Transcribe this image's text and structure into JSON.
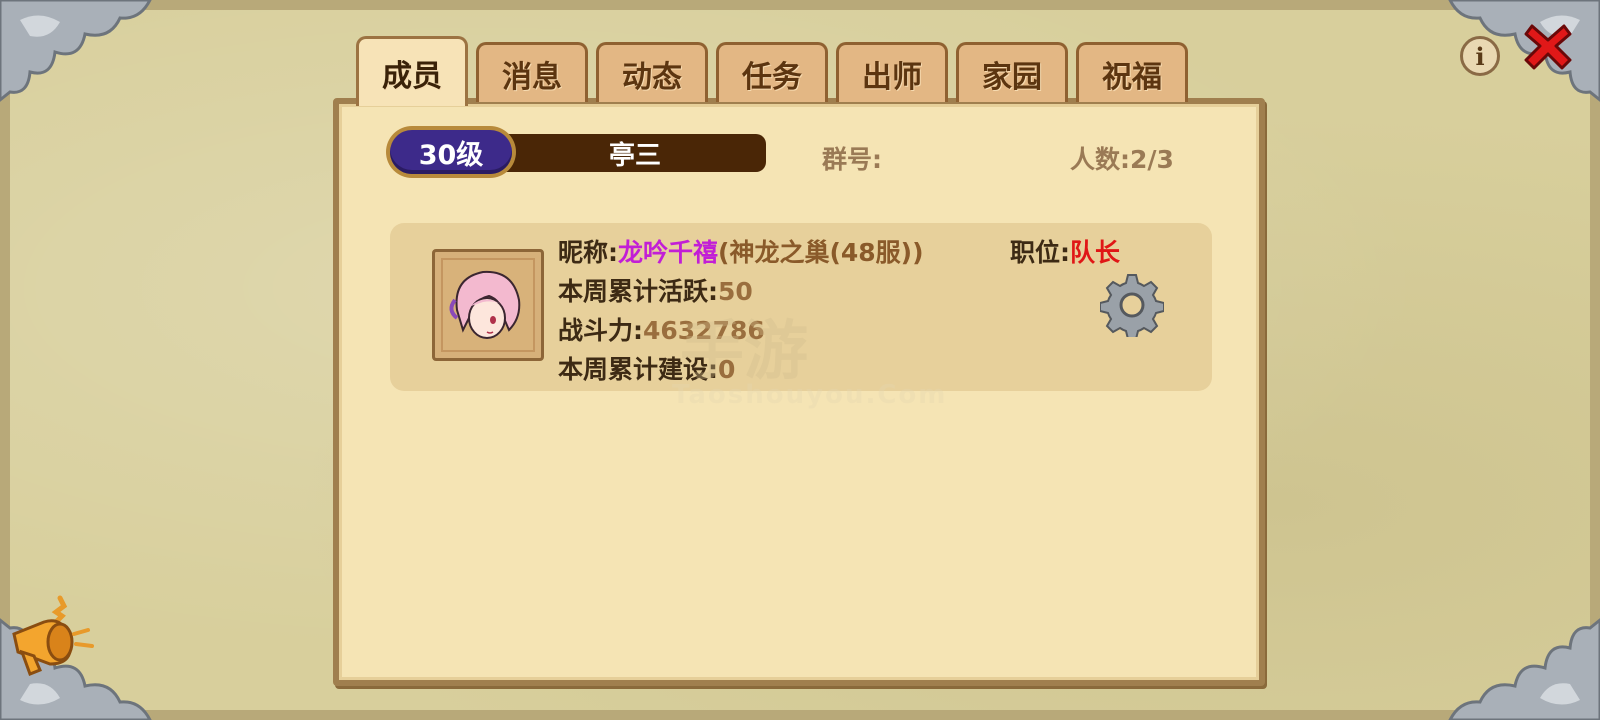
{
  "tabs": [
    "成员",
    "消息",
    "动态",
    "任务",
    "出师",
    "家园",
    "祝福"
  ],
  "active_tab_index": 0,
  "group": {
    "level": "30级",
    "name": "亭三",
    "group_number_label": "群号:",
    "member_count_label": "人数:",
    "member_count": "2/3"
  },
  "member": {
    "nickname_label": "昵称:",
    "nickname": "龙吟千禧",
    "server": "(神龙之巢(48服))",
    "weekly_activity_label": "本周累计活跃:",
    "weekly_activity": "50",
    "power_label": "战斗力:",
    "power": "4632786",
    "weekly_build_label": "本周累计建设:",
    "weekly_build": "0",
    "position_label": "职位:",
    "position": "队长"
  },
  "watermark": {
    "text": "手游",
    "subtext": "Taoshouyou.Com"
  },
  "icons": {
    "info": "info-icon",
    "close": "close-icon",
    "settings": "gear-icon",
    "horn": "horn-icon"
  },
  "colors": {
    "nickname": "#c21ed6",
    "position_leader": "#e01616",
    "level_badge": "#3d2a8a",
    "name_bar": "#4a2606"
  }
}
